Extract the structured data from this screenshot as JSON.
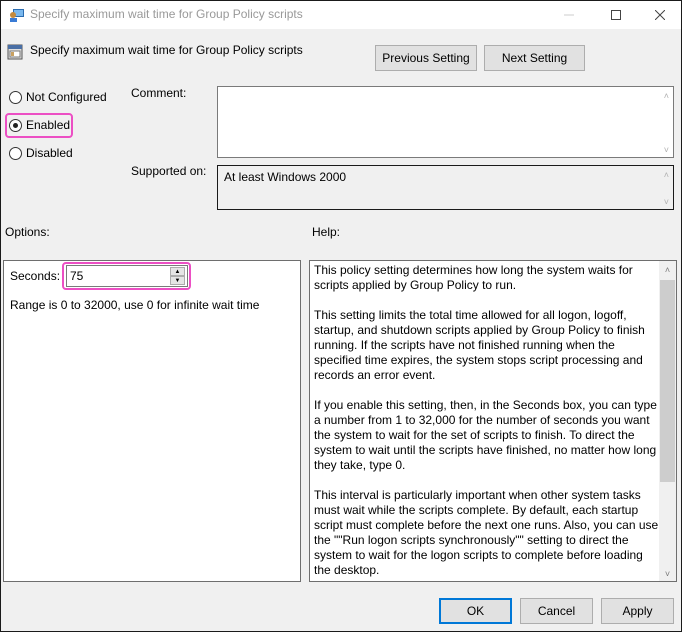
{
  "window": {
    "title": "Specify maximum wait time for Group Policy scripts",
    "controls": {
      "minimize": "—",
      "maximize": "☐",
      "close": "✕"
    }
  },
  "header": {
    "policy_title": "Specify maximum wait time for Group Policy scripts",
    "previous_label": "Previous Setting",
    "next_label": "Next Setting"
  },
  "state": {
    "options": [
      {
        "label": "Not Configured",
        "checked": false
      },
      {
        "label": "Enabled",
        "checked": true
      },
      {
        "label": "Disabled",
        "checked": false
      }
    ]
  },
  "comment": {
    "label": "Comment:",
    "value": ""
  },
  "supported": {
    "label": "Supported on:",
    "value": "At least Windows 2000"
  },
  "options_panel": {
    "label": "Options:",
    "seconds_label": "Seconds:",
    "seconds_value": "75",
    "range_text": "Range is 0 to 32000, use 0 for infinite wait time"
  },
  "help": {
    "label": "Help:",
    "paragraphs": [
      "This policy setting determines how long the system waits for scripts applied by Group Policy to run.",
      "This setting limits the total time allowed for all logon, logoff, startup, and shutdown scripts applied by Group Policy to finish running. If the scripts have not finished running when the specified time expires, the system stops script processing and records an error event.",
      "If you enable this setting, then, in the Seconds box, you can type a number from 1 to 32,000 for the number of seconds you want the system to wait for the set of scripts to finish. To direct the system to wait until the scripts have finished, no matter how long they take, type 0.",
      "This interval is particularly important when other system tasks must wait while the scripts complete. By default, each startup script must complete before the next one runs. Also, you can use the \"\"Run logon scripts synchronously\"\" setting to direct the system to wait for the logon scripts to complete before loading the desktop."
    ]
  },
  "footer": {
    "ok_label": "OK",
    "cancel_label": "Cancel",
    "apply_label": "Apply"
  },
  "icons": {
    "up_arrow": "▲",
    "down_arrow": "▼",
    "scroll_up": "˄",
    "scroll_down": "˅"
  }
}
